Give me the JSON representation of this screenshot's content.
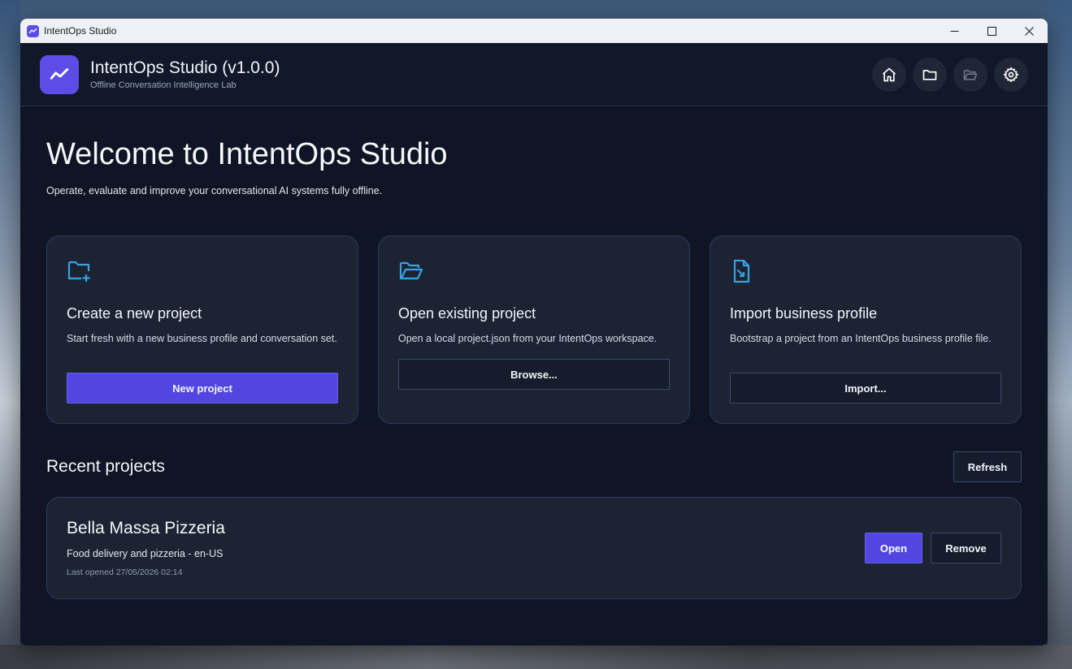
{
  "window": {
    "title": "IntentOps Studio",
    "controls": {
      "minimize": "minimize-icon",
      "maximize": "maximize-icon",
      "close": "close-icon"
    }
  },
  "header": {
    "title": "IntentOps Studio (v1.0.0)",
    "subtitle": "Offline Conversation Intelligence Lab",
    "actions": [
      "home-icon",
      "folder-icon",
      "folder-open-icon",
      "gear-icon"
    ]
  },
  "welcome": {
    "title": "Welcome to IntentOps Studio",
    "subtitle": "Operate, evaluate and improve your conversational AI systems fully offline."
  },
  "cards": [
    {
      "icon": "folder-add-icon",
      "title": "Create a new project",
      "description": "Start fresh with a new business profile and conversation set.",
      "button": "New project"
    },
    {
      "icon": "folder-open-icon",
      "title": "Open existing project",
      "description": "Open a local project.json from your IntentOps workspace.",
      "button": "Browse..."
    },
    {
      "icon": "file-import-icon",
      "title": "Import business profile",
      "description": "Bootstrap a project from an IntentOps business profile file.",
      "button": "Import..."
    }
  ],
  "recent": {
    "title": "Recent projects",
    "refresh_label": "Refresh",
    "projects": [
      {
        "name": "Bella Massa Pizzeria",
        "description": "Food delivery and pizzeria - en-US",
        "last_opened": "Last opened 27/05/2026 02:14",
        "open_label": "Open",
        "remove_label": "Remove"
      }
    ]
  },
  "colors": {
    "accent": "#5246e0",
    "icon_accent": "#3aa0e0",
    "background": "#0f1524",
    "card": "#1c2434"
  }
}
